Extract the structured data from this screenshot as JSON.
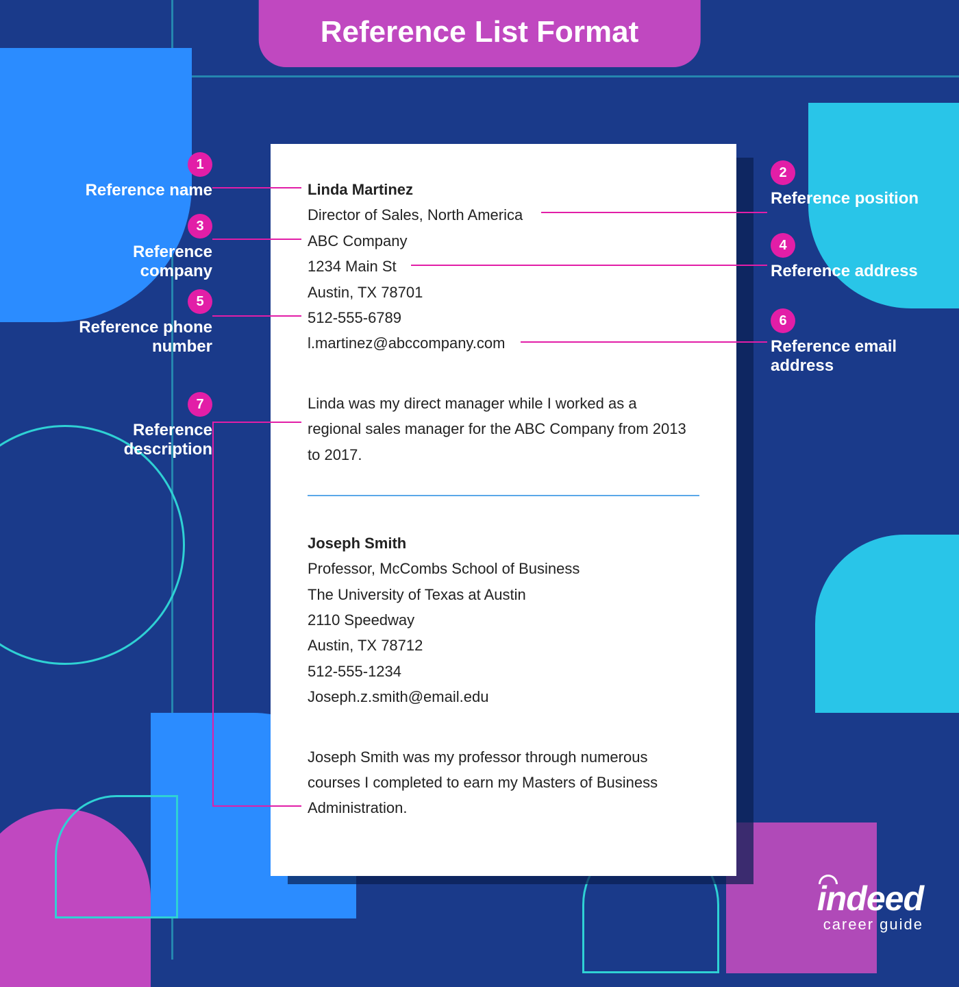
{
  "title": "Reference List Format",
  "callouts": [
    {
      "num": "1",
      "label": "Reference name"
    },
    {
      "num": "2",
      "label": "Reference position"
    },
    {
      "num": "3",
      "label": "Reference\ncompany"
    },
    {
      "num": "4",
      "label": "Reference address"
    },
    {
      "num": "5",
      "label": "Reference phone\nnumber"
    },
    {
      "num": "6",
      "label": "Reference email\naddress"
    },
    {
      "num": "7",
      "label": "Reference\ndescription"
    }
  ],
  "references": [
    {
      "name": "Linda Martinez",
      "position": "Director of Sales, North America",
      "company": "ABC Company",
      "address1": "1234 Main St",
      "address2": "Austin, TX 78701",
      "phone": "512-555-6789",
      "email": "l.martinez@abccompany.com",
      "description": "Linda was my direct manager while I worked as a regional sales manager for the ABC Company from 2013 to 2017."
    },
    {
      "name": "Joseph Smith",
      "position": "Professor, McCombs School of Business",
      "company": "The University of Texas at Austin",
      "address1": "2110 Speedway",
      "address2": "Austin, TX 78712",
      "phone": "512-555-1234",
      "email": "Joseph.z.smith@email.edu",
      "description": "Joseph Smith was my professor through numerous courses I completed to earn my Masters of Business Administration."
    }
  ],
  "logo": {
    "brand": "indeed",
    "sub": "career guide"
  }
}
